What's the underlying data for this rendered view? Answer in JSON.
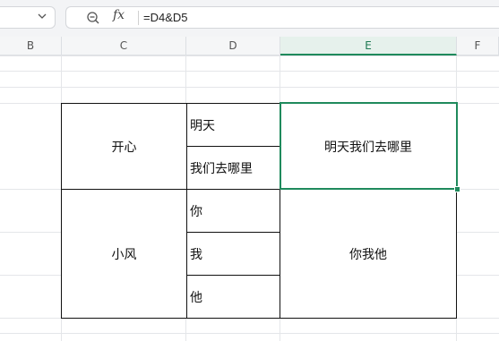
{
  "formula_bar": {
    "formula": "=D4&D5",
    "fx_label": "fx"
  },
  "columns": [
    "B",
    "C",
    "D",
    "E",
    "F"
  ],
  "active_column": "E",
  "cells": {
    "c_merged_top": "开心",
    "c_merged_bottom": "小风",
    "d4": "明天",
    "d5": "我们去哪里",
    "d6": "你",
    "d7": "我",
    "d8": "他",
    "e_merged_top": "明天我们去哪里",
    "e_merged_bottom": "你我他"
  },
  "colors": {
    "accent": "#1f8a5c",
    "toolbar_bg": "#f3f4f6",
    "header_bg": "#f5f6f7"
  }
}
